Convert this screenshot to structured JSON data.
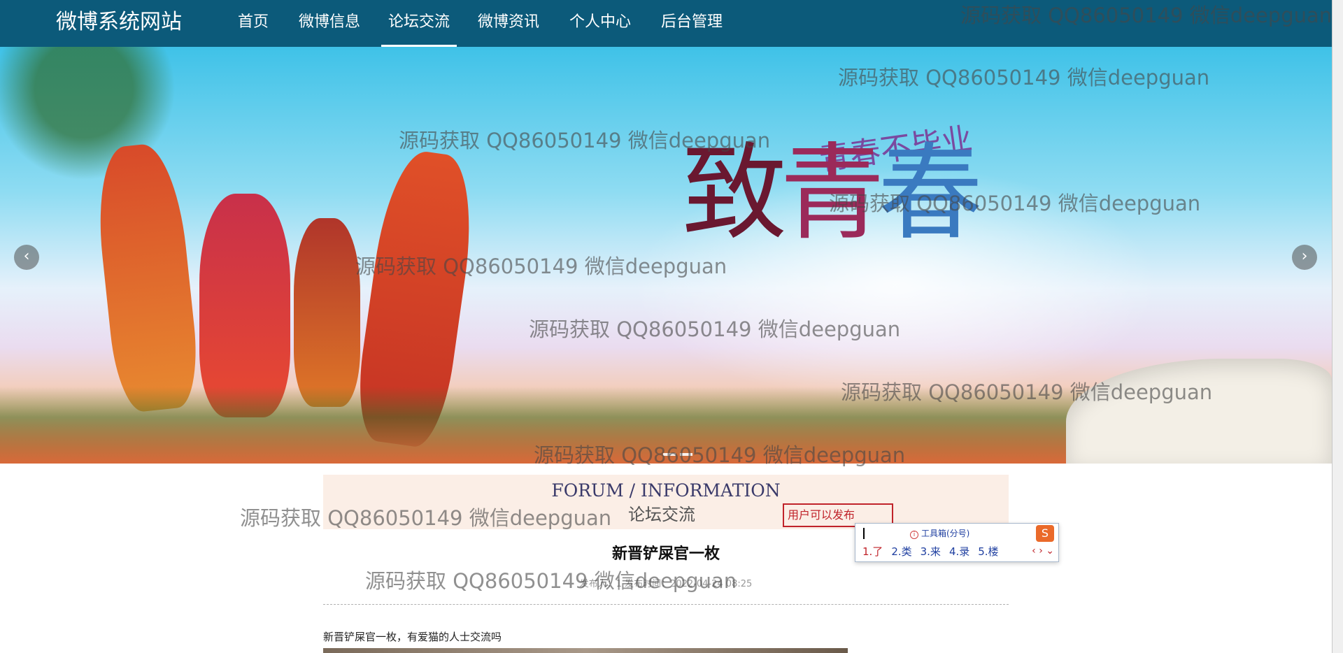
{
  "nav": {
    "brand": "微博系统网站",
    "items": [
      {
        "label": "首页"
      },
      {
        "label": "微博信息"
      },
      {
        "label": "论坛交流",
        "active": true
      },
      {
        "label": "微博资讯"
      },
      {
        "label": "个人中心"
      },
      {
        "label": "后台管理"
      }
    ]
  },
  "banner": {
    "title_chars": [
      "致",
      "青",
      "春"
    ],
    "subtitle": "青春不毕业",
    "prev_icon": "chevron-left-icon",
    "next_icon": "chevron-right-icon",
    "prev_glyph": "‹",
    "next_glyph": "›"
  },
  "section": {
    "heading_en": "FORUM / INFORMATION",
    "heading_cn": "论坛交流",
    "notice": "用户可以发布"
  },
  "ime": {
    "toolbox_label": "工具箱(分号)",
    "logo": "S",
    "candidates": [
      "1.了",
      "2.类",
      "3.来",
      "4.录",
      "5.楼"
    ],
    "nav": "‹ › ⌄"
  },
  "post": {
    "title": "新晋铲屎官一枚",
    "meta": "发布人：1  发布时间：2022-04-24 08:25",
    "body": "新晋铲屎官一枚，有爱猫的人士交流吗"
  },
  "watermark": {
    "text": "源码获取 QQ86050149 微信deepguan"
  },
  "colors": {
    "nav_bg": "#0c5a7a",
    "section_bg": "#fbeee6",
    "notice_border": "#c0232a"
  }
}
